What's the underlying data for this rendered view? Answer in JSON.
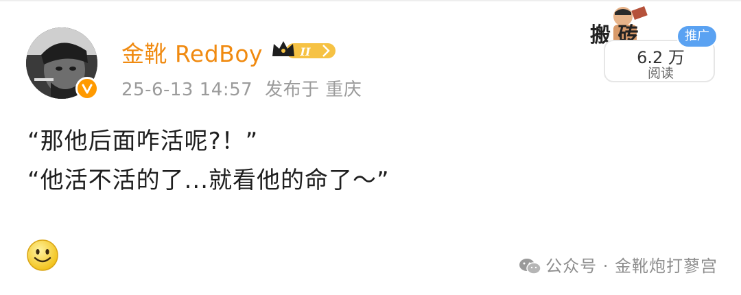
{
  "post": {
    "author": {
      "name": "金靴 RedBoy",
      "vip_level": "II"
    },
    "meta": {
      "date": "25-6-13 14:57",
      "location": "发布于 重庆"
    },
    "content": {
      "line1": "“那他后面咋活呢?！”",
      "line2": "“他活不活的了...就看他的命了～”"
    },
    "sticker_text": "搬  砖",
    "stats": {
      "views_count": "6.2 万",
      "views_label": "阅读",
      "promo_label": "推广"
    },
    "reaction_icon": "smiley-emoji"
  },
  "watermark": {
    "text": "公众号 · 金靴炮打蓼宫",
    "icon": "wechat-icon"
  },
  "colors": {
    "username": "#f08a10",
    "meta": "#9b9b9b",
    "verified_badge": "#ff9a00",
    "promo_badge": "#5aa2f2"
  }
}
